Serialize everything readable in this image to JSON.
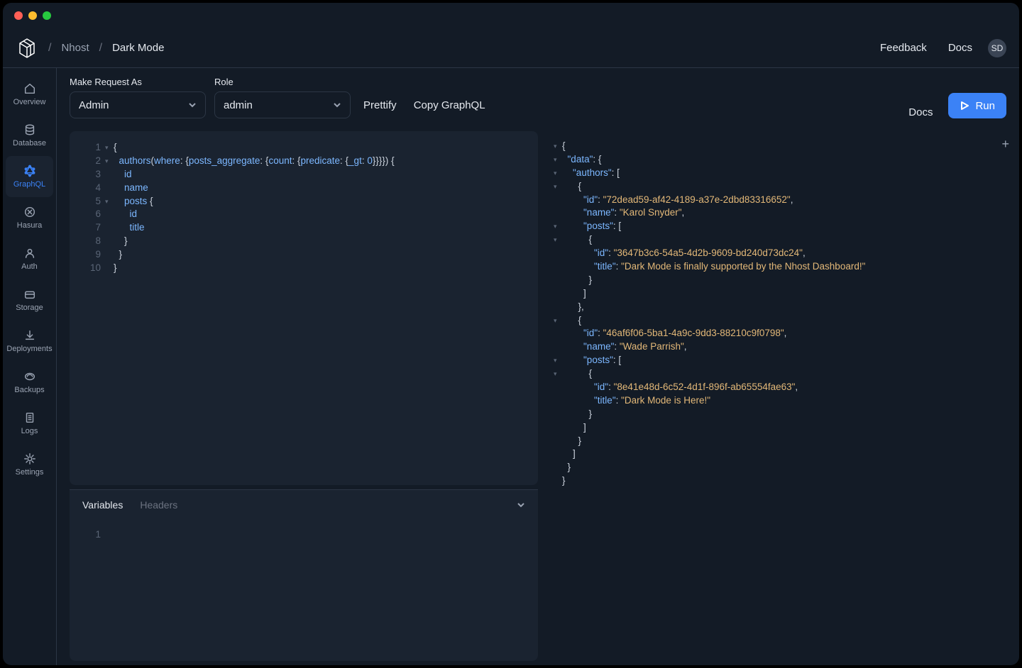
{
  "titlebar": {
    "app": "nhost-dashboard"
  },
  "header": {
    "breadcrumb": [
      "Nhost",
      "Dark Mode"
    ],
    "feedback": "Feedback",
    "docs": "Docs",
    "avatar": "SD"
  },
  "sidebar": [
    {
      "icon": "overview",
      "label": "Overview"
    },
    {
      "icon": "database",
      "label": "Database"
    },
    {
      "icon": "graphql",
      "label": "GraphQL",
      "active": true
    },
    {
      "icon": "hasura",
      "label": "Hasura"
    },
    {
      "icon": "auth",
      "label": "Auth"
    },
    {
      "icon": "storage",
      "label": "Storage"
    },
    {
      "icon": "deployments",
      "label": "Deployments"
    },
    {
      "icon": "backups",
      "label": "Backups"
    },
    {
      "icon": "logs",
      "label": "Logs"
    },
    {
      "icon": "settings",
      "label": "Settings"
    }
  ],
  "toolbar": {
    "make_as_label": "Make Request As",
    "make_as_value": "Admin",
    "role_label": "Role",
    "role_value": "admin",
    "prettify": "Prettify",
    "copy": "Copy GraphQL",
    "docs": "Docs",
    "run": "Run"
  },
  "query_lines": [
    {
      "n": 1,
      "fold": true,
      "tokens": [
        {
          "t": "pln",
          "v": "{"
        }
      ]
    },
    {
      "n": 2,
      "fold": true,
      "tokens": [
        {
          "t": "pln",
          "v": "  "
        },
        {
          "t": "key",
          "v": "authors"
        },
        {
          "t": "pln",
          "v": "("
        },
        {
          "t": "key",
          "v": "where"
        },
        {
          "t": "pln",
          "v": ": {"
        },
        {
          "t": "key",
          "v": "posts_aggregate"
        },
        {
          "t": "pln",
          "v": ": {"
        },
        {
          "t": "key",
          "v": "count"
        },
        {
          "t": "pln",
          "v": ": {"
        },
        {
          "t": "key",
          "v": "predicate"
        },
        {
          "t": "pln",
          "v": ": {"
        },
        {
          "t": "key",
          "v": "_gt"
        },
        {
          "t": "pln",
          "v": ": "
        },
        {
          "t": "key",
          "v": "0"
        },
        {
          "t": "pln",
          "v": "}}}}) {"
        }
      ]
    },
    {
      "n": 3,
      "tokens": [
        {
          "t": "pln",
          "v": "    "
        },
        {
          "t": "key",
          "v": "id"
        }
      ]
    },
    {
      "n": 4,
      "tokens": [
        {
          "t": "pln",
          "v": "    "
        },
        {
          "t": "key",
          "v": "name"
        }
      ]
    },
    {
      "n": 5,
      "fold": true,
      "tokens": [
        {
          "t": "pln",
          "v": "    "
        },
        {
          "t": "key",
          "v": "posts"
        },
        {
          "t": "pln",
          "v": " {"
        }
      ]
    },
    {
      "n": 6,
      "tokens": [
        {
          "t": "pln",
          "v": "      "
        },
        {
          "t": "key",
          "v": "id"
        }
      ]
    },
    {
      "n": 7,
      "tokens": [
        {
          "t": "pln",
          "v": "      "
        },
        {
          "t": "key",
          "v": "title"
        }
      ]
    },
    {
      "n": 8,
      "tokens": [
        {
          "t": "pln",
          "v": "    }"
        }
      ]
    },
    {
      "n": 9,
      "tokens": [
        {
          "t": "pln",
          "v": "  }"
        }
      ]
    },
    {
      "n": 10,
      "tokens": [
        {
          "t": "pln",
          "v": "}"
        }
      ]
    }
  ],
  "response_lines": [
    {
      "fold": true,
      "tokens": [
        {
          "t": "pln",
          "v": "{"
        }
      ]
    },
    {
      "fold": true,
      "tokens": [
        {
          "t": "pln",
          "v": "  "
        },
        {
          "t": "key",
          "v": "\"data\""
        },
        {
          "t": "pln",
          "v": ": {"
        }
      ]
    },
    {
      "fold": true,
      "tokens": [
        {
          "t": "pln",
          "v": "    "
        },
        {
          "t": "key",
          "v": "\"authors\""
        },
        {
          "t": "pln",
          "v": ": ["
        }
      ]
    },
    {
      "fold": true,
      "tokens": [
        {
          "t": "pln",
          "v": "      {"
        }
      ]
    },
    {
      "tokens": [
        {
          "t": "pln",
          "v": "        "
        },
        {
          "t": "key",
          "v": "\"id\""
        },
        {
          "t": "pln",
          "v": ": "
        },
        {
          "t": "str",
          "v": "\"72dead59-af42-4189-a37e-2dbd83316652\""
        },
        {
          "t": "pln",
          "v": ","
        }
      ]
    },
    {
      "tokens": [
        {
          "t": "pln",
          "v": "        "
        },
        {
          "t": "key",
          "v": "\"name\""
        },
        {
          "t": "pln",
          "v": ": "
        },
        {
          "t": "str",
          "v": "\"Karol Snyder\""
        },
        {
          "t": "pln",
          "v": ","
        }
      ]
    },
    {
      "fold": true,
      "tokens": [
        {
          "t": "pln",
          "v": "        "
        },
        {
          "t": "key",
          "v": "\"posts\""
        },
        {
          "t": "pln",
          "v": ": ["
        }
      ]
    },
    {
      "fold": true,
      "tokens": [
        {
          "t": "pln",
          "v": "          {"
        }
      ]
    },
    {
      "tokens": [
        {
          "t": "pln",
          "v": "            "
        },
        {
          "t": "key",
          "v": "\"id\""
        },
        {
          "t": "pln",
          "v": ": "
        },
        {
          "t": "str",
          "v": "\"3647b3c6-54a5-4d2b-9609-bd240d73dc24\""
        },
        {
          "t": "pln",
          "v": ","
        }
      ]
    },
    {
      "tokens": [
        {
          "t": "pln",
          "v": "            "
        },
        {
          "t": "key",
          "v": "\"title\""
        },
        {
          "t": "pln",
          "v": ": "
        },
        {
          "t": "str",
          "v": "\"Dark Mode is finally supported by the Nhost Dashboard!\""
        }
      ]
    },
    {
      "tokens": [
        {
          "t": "pln",
          "v": "          }"
        }
      ]
    },
    {
      "tokens": [
        {
          "t": "pln",
          "v": "        ]"
        }
      ]
    },
    {
      "tokens": [
        {
          "t": "pln",
          "v": "      },"
        }
      ]
    },
    {
      "fold": true,
      "tokens": [
        {
          "t": "pln",
          "v": "      {"
        }
      ]
    },
    {
      "tokens": [
        {
          "t": "pln",
          "v": "        "
        },
        {
          "t": "key",
          "v": "\"id\""
        },
        {
          "t": "pln",
          "v": ": "
        },
        {
          "t": "str",
          "v": "\"46af6f06-5ba1-4a9c-9dd3-88210c9f0798\""
        },
        {
          "t": "pln",
          "v": ","
        }
      ]
    },
    {
      "tokens": [
        {
          "t": "pln",
          "v": "        "
        },
        {
          "t": "key",
          "v": "\"name\""
        },
        {
          "t": "pln",
          "v": ": "
        },
        {
          "t": "str",
          "v": "\"Wade Parrish\""
        },
        {
          "t": "pln",
          "v": ","
        }
      ]
    },
    {
      "fold": true,
      "tokens": [
        {
          "t": "pln",
          "v": "        "
        },
        {
          "t": "key",
          "v": "\"posts\""
        },
        {
          "t": "pln",
          "v": ": ["
        }
      ]
    },
    {
      "fold": true,
      "tokens": [
        {
          "t": "pln",
          "v": "          {"
        }
      ]
    },
    {
      "tokens": [
        {
          "t": "pln",
          "v": "            "
        },
        {
          "t": "key",
          "v": "\"id\""
        },
        {
          "t": "pln",
          "v": ": "
        },
        {
          "t": "str",
          "v": "\"8e41e48d-6c52-4d1f-896f-ab65554fae63\""
        },
        {
          "t": "pln",
          "v": ","
        }
      ]
    },
    {
      "tokens": [
        {
          "t": "pln",
          "v": "            "
        },
        {
          "t": "key",
          "v": "\"title\""
        },
        {
          "t": "pln",
          "v": ": "
        },
        {
          "t": "str",
          "v": "\"Dark Mode is Here!\""
        }
      ]
    },
    {
      "tokens": [
        {
          "t": "pln",
          "v": "          }"
        }
      ]
    },
    {
      "tokens": [
        {
          "t": "pln",
          "v": "        ]"
        }
      ]
    },
    {
      "tokens": [
        {
          "t": "pln",
          "v": "      }"
        }
      ]
    },
    {
      "tokens": [
        {
          "t": "pln",
          "v": "    ]"
        }
      ]
    },
    {
      "tokens": [
        {
          "t": "pln",
          "v": "  }"
        }
      ]
    },
    {
      "tokens": [
        {
          "t": "pln",
          "v": "}"
        }
      ]
    }
  ],
  "vars": {
    "tab_variables": "Variables",
    "tab_headers": "Headers",
    "line": "1"
  }
}
